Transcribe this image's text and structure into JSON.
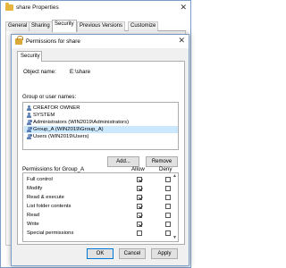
{
  "back_window": {
    "title": "share Properties",
    "tabs": [
      "General",
      "Sharing",
      "Security",
      "Previous Versions",
      "Customize"
    ],
    "active_tab": "Security"
  },
  "dialog": {
    "title": "Permissions for share",
    "tab": "Security",
    "object_name_label": "Object name:",
    "object_name_value": "E:\\share",
    "group_label": "Group or user names:",
    "users": [
      {
        "name": "CREATOR OWNER",
        "icon": "user-icon",
        "selected": false
      },
      {
        "name": "SYSTEM",
        "icon": "user-icon",
        "selected": false
      },
      {
        "name": "Administrators (WIN2019\\Administrators)",
        "icon": "group-icon",
        "selected": false
      },
      {
        "name": "Group_A (WIN2019\\Group_A)",
        "icon": "group-icon",
        "selected": true
      },
      {
        "name": "Users (WIN2019\\Users)",
        "icon": "group-icon",
        "selected": false
      }
    ],
    "add_label": "Add...",
    "remove_label": "Remove",
    "perm_for_label": "Permissions for Group_A",
    "allow_label": "Allow",
    "deny_label": "Deny",
    "permissions": [
      {
        "name": "Full control",
        "allow": true,
        "deny": false
      },
      {
        "name": "Modify",
        "allow": true,
        "deny": false
      },
      {
        "name": "Read & execute",
        "allow": true,
        "deny": false
      },
      {
        "name": "List folder contents",
        "allow": true,
        "deny": false
      },
      {
        "name": "Read",
        "allow": true,
        "deny": false
      },
      {
        "name": "Write",
        "allow": true,
        "deny": false
      },
      {
        "name": "Special permissions",
        "allow": false,
        "deny": false
      }
    ],
    "ok_label": "OK",
    "cancel_label": "Cancel",
    "apply_label": "Apply"
  },
  "colors": {
    "selection": "#cce8ff",
    "window_border": "#7a9ec8",
    "default_button_border": "#0078d7"
  }
}
